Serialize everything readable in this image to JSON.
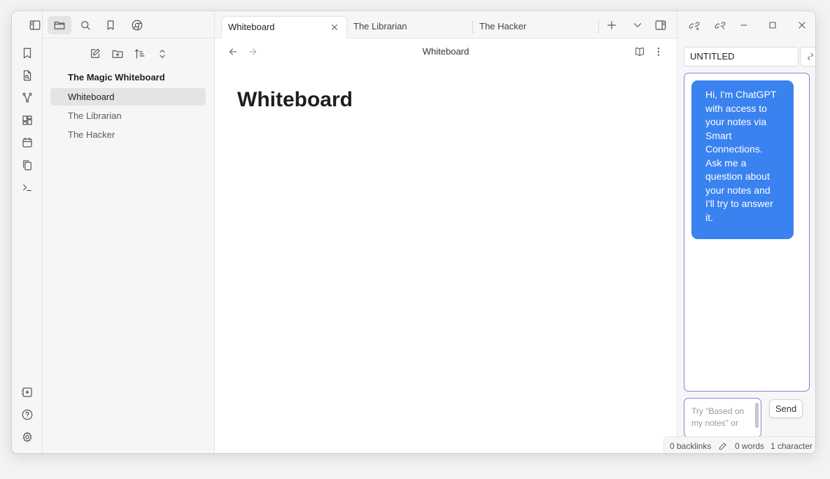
{
  "ribbon": {
    "top_icons": [
      "bookmark-icon",
      "file-search-icon",
      "graph-icon",
      "dashboard-icon",
      "calendar-icon",
      "copy-icon",
      "terminal-icon"
    ],
    "bottom_icons": [
      "vault-icon",
      "help-icon",
      "settings-icon"
    ]
  },
  "explorer": {
    "top_icons": [
      "sidebar-toggle-icon",
      "folder-icon",
      "search-icon",
      "bookmark-icon",
      "chrome-icon"
    ],
    "actions": [
      "new-note-icon",
      "new-folder-icon",
      "sort-icon",
      "collapse-icon"
    ],
    "vault_name": "The Magic Whiteboard",
    "files": [
      {
        "name": "Whiteboard",
        "active": true
      },
      {
        "name": "The Librarian",
        "active": false
      },
      {
        "name": "The Hacker",
        "active": false
      }
    ]
  },
  "tabs": [
    {
      "label": "Whiteboard",
      "active": true
    },
    {
      "label": "The Librarian",
      "active": false
    },
    {
      "label": "The Hacker",
      "active": false
    }
  ],
  "view": {
    "header_title": "Whiteboard",
    "note_title": "Whiteboard"
  },
  "chat": {
    "name": "UNTITLED",
    "greeting": "Hi, I'm ChatGPT with access to your notes via Smart Connections. Ask me a question about your notes and I'll try to answer it.",
    "input_placeholder": "Try \"Based on my notes\" or",
    "send_label": "Send",
    "bubble_color": "#3a82f0",
    "border_color": "#8b7fe0"
  },
  "status": {
    "backlinks": "0 backlinks",
    "words": "0 words",
    "characters": "1 character"
  }
}
